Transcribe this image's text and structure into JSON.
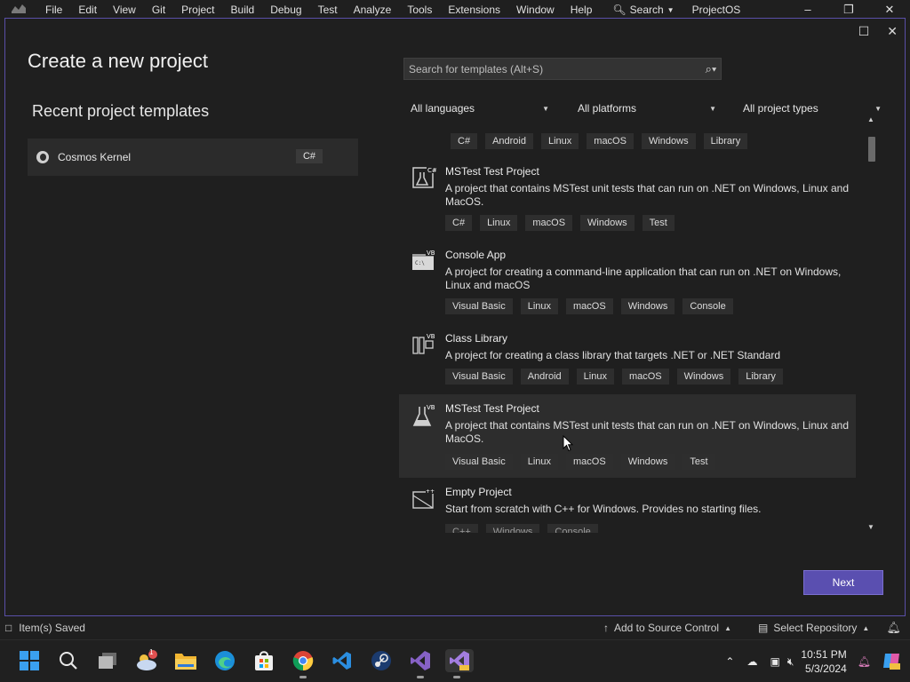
{
  "menubar": {
    "items": [
      "File",
      "Edit",
      "View",
      "Git",
      "Project",
      "Build",
      "Debug",
      "Test",
      "Analyze",
      "Tools",
      "Extensions",
      "Window",
      "Help"
    ],
    "search_label": "Search",
    "project_name": "ProjectOS"
  },
  "dialog": {
    "title": "Create a new project",
    "recent_title": "Recent project templates",
    "recent_items": [
      {
        "name": "Cosmos Kernel",
        "lang": "C#"
      }
    ],
    "search_placeholder": "Search for templates (Alt+S)",
    "filters": {
      "languages": "All languages",
      "platforms": "All platforms",
      "types": "All project types"
    },
    "next_label": "Next"
  },
  "templates": [
    {
      "name": "",
      "desc": "",
      "tags": [
        "C#",
        "Android",
        "Linux",
        "macOS",
        "Windows",
        "Library"
      ]
    },
    {
      "name": "MSTest Test Project",
      "desc": "A project that contains MSTest unit tests that can run on .NET on Windows, Linux and MacOS.",
      "tags": [
        "C#",
        "Linux",
        "macOS",
        "Windows",
        "Test"
      ],
      "icon": "mstest-csharp-icon"
    },
    {
      "name": "Console App",
      "desc": "A project for creating a command-line application that can run on .NET on Windows, Linux and macOS",
      "tags": [
        "Visual Basic",
        "Linux",
        "macOS",
        "Windows",
        "Console"
      ],
      "icon": "console-vb-icon"
    },
    {
      "name": "Class Library",
      "desc": "A project for creating a class library that targets .NET or .NET Standard",
      "tags": [
        "Visual Basic",
        "Android",
        "Linux",
        "macOS",
        "Windows",
        "Library"
      ],
      "icon": "class-library-vb-icon"
    },
    {
      "name": "MSTest Test Project",
      "desc": "A project that contains MSTest unit tests that can run on .NET on Windows, Linux and MacOS.",
      "tags": [
        "Visual Basic",
        "Linux",
        "macOS",
        "Windows",
        "Test"
      ],
      "icon": "mstest-vb-icon"
    },
    {
      "name": "Empty Project",
      "desc": "Start from scratch with C++ for Windows. Provides no starting files.",
      "tags": [
        "C++",
        "Windows",
        "Console"
      ],
      "icon": "empty-project-cpp-icon"
    }
  ],
  "statusbar": {
    "saved": "Item(s) Saved",
    "source_control": "Add to Source Control",
    "select_repo": "Select Repository"
  },
  "taskbar": {
    "time": "10:51 PM",
    "date": "5/3/2024",
    "weather_badge": "1"
  },
  "colors": {
    "accent": "#5a4fb0",
    "dialog_border": "#5a4fa8",
    "background": "#1f1f1f"
  }
}
